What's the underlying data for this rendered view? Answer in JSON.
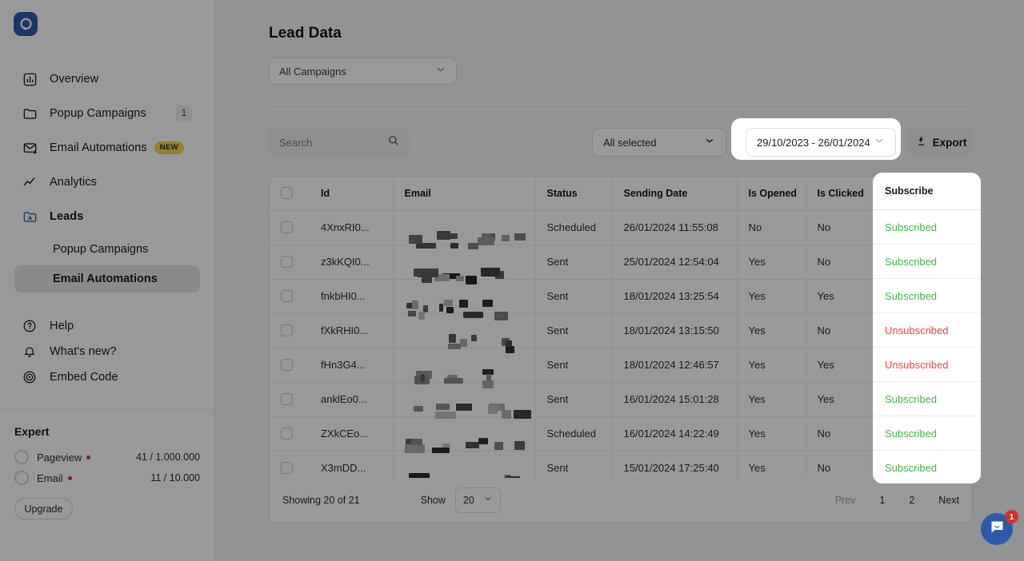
{
  "brand": {
    "logo_icon": "popupsmart-logo-icon",
    "accent": "#2e5aac"
  },
  "sidebar": {
    "items": [
      {
        "label": "Overview",
        "icon": "chart-bar-icon",
        "badge": null,
        "new": false,
        "bold": false
      },
      {
        "label": "Popup Campaigns",
        "icon": "folder-icon",
        "badge": "1",
        "new": false,
        "bold": false
      },
      {
        "label": "Email Automations",
        "icon": "mail-forward-icon",
        "badge": null,
        "new": true,
        "bold": false
      },
      {
        "label": "Analytics",
        "icon": "trend-line-icon",
        "badge": null,
        "new": false,
        "bold": false
      },
      {
        "label": "Leads",
        "icon": "folder-user-icon",
        "badge": null,
        "new": false,
        "bold": true
      }
    ],
    "new_badge_text": "NEW",
    "sub_items": [
      {
        "label": "Popup Campaigns",
        "active": false
      },
      {
        "label": "Email Automations",
        "active": true
      }
    ],
    "footer_items": [
      {
        "label": "Help",
        "icon": "question-circle-icon"
      },
      {
        "label": "What's new?",
        "icon": "bell-icon"
      },
      {
        "label": "Embed Code",
        "icon": "broadcast-icon"
      }
    ],
    "plan": {
      "title": "Expert",
      "meters": [
        {
          "label": "Pageview",
          "value": "41 / 1.000.000",
          "status_color": "#d13b3b"
        },
        {
          "label": "Email",
          "value": "11 / 10.000",
          "status_color": "#d13b3b"
        }
      ],
      "upgrade_label": "Upgrade"
    }
  },
  "main": {
    "title": "Lead Data",
    "campaign_filter": {
      "value": "All Campaigns",
      "icon": "chevron-down-icon"
    },
    "toolbar": {
      "search_placeholder": "Search",
      "search_value": "",
      "search_icon": "search-icon",
      "all_selected": "All selected",
      "date_range": "29/10/2023 - 26/01/2024",
      "export_label": "Export",
      "export_icon": "download-bolt-icon"
    },
    "table": {
      "columns": [
        "Id",
        "Email",
        "Status",
        "Sending Date",
        "Is Opened",
        "Is Clicked",
        "Subscribe"
      ],
      "rows": [
        {
          "id": "4XnxRI0...",
          "email": "",
          "status": "Scheduled",
          "sending_date": "26/01/2024 11:55:08",
          "is_opened": "No",
          "is_clicked": "No",
          "subscribe": "Subscribed"
        },
        {
          "id": "z3kKQI0...",
          "email": "",
          "status": "Sent",
          "sending_date": "25/01/2024 12:54:04",
          "is_opened": "Yes",
          "is_clicked": "No",
          "subscribe": "Subscribed"
        },
        {
          "id": "fnkbHI0...",
          "email": "",
          "status": "Sent",
          "sending_date": "18/01/2024 13:25:54",
          "is_opened": "Yes",
          "is_clicked": "Yes",
          "subscribe": "Subscribed"
        },
        {
          "id": "fXkRHI0...",
          "email": "",
          "status": "Sent",
          "sending_date": "18/01/2024 13:15:50",
          "is_opened": "Yes",
          "is_clicked": "No",
          "subscribe": "Unsubscribed"
        },
        {
          "id": "fHn3G4...",
          "email": "",
          "status": "Sent",
          "sending_date": "18/01/2024 12:46:57",
          "is_opened": "Yes",
          "is_clicked": "Yes",
          "subscribe": "Unsubscribed"
        },
        {
          "id": "anklEo0...",
          "email": "",
          "status": "Sent",
          "sending_date": "16/01/2024 15:01:28",
          "is_opened": "Yes",
          "is_clicked": "Yes",
          "subscribe": "Subscribed"
        },
        {
          "id": "ZXkCEo...",
          "email": "",
          "status": "Scheduled",
          "sending_date": "16/01/2024 14:22:49",
          "is_opened": "Yes",
          "is_clicked": "No",
          "subscribe": "Subscribed"
        },
        {
          "id": "X3mDD...",
          "email": "",
          "status": "Sent",
          "sending_date": "15/01/2024 17:25:40",
          "is_opened": "Yes",
          "is_clicked": "No",
          "subscribe": "Subscribed"
        }
      ]
    },
    "footer": {
      "showing": "Showing 20 of 21",
      "show_label": "Show",
      "page_size": "20",
      "prev": "Prev",
      "pages": [
        "1",
        "2"
      ],
      "next": "Next"
    }
  },
  "chat": {
    "icon": "chat-bubble-icon",
    "unread": "1"
  },
  "colors": {
    "subscribed": "#4caf50",
    "unsubscribed": "#f4433a",
    "new_badge": "#f5d44a"
  }
}
